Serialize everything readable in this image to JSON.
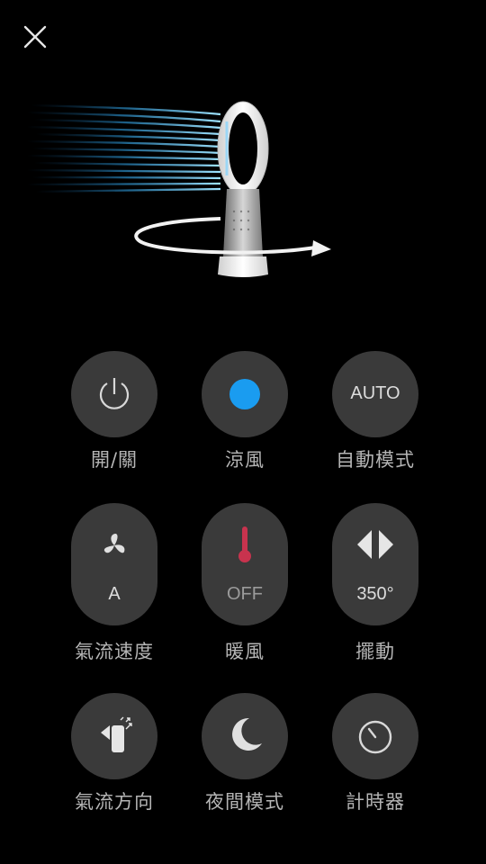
{
  "header": {
    "close_icon": "close-icon"
  },
  "hero": {
    "image": "fan-oscillation-illustration"
  },
  "controls": {
    "power": {
      "label": "開/關",
      "icon": "power-icon"
    },
    "cooling": {
      "label": "涼風",
      "icon": "blue-dot-icon",
      "accent": "#1a9cf0"
    },
    "auto": {
      "label": "自動模式",
      "badge": "AUTO"
    },
    "airflow": {
      "label": "氣流速度",
      "icon": "fan-icon",
      "value": "A"
    },
    "heating": {
      "label": "暖風",
      "icon": "thermometer-icon",
      "value": "OFF",
      "accent": "#c8334e"
    },
    "oscillation": {
      "label": "擺動",
      "icon": "oscillation-arrows-icon",
      "value": "350°"
    },
    "airflow_direction": {
      "label": "氣流方向",
      "icon": "airflow-direction-icon"
    },
    "night_mode": {
      "label": "夜間模式",
      "icon": "moon-icon"
    },
    "timer": {
      "label": "計時器",
      "icon": "timer-icon"
    }
  }
}
